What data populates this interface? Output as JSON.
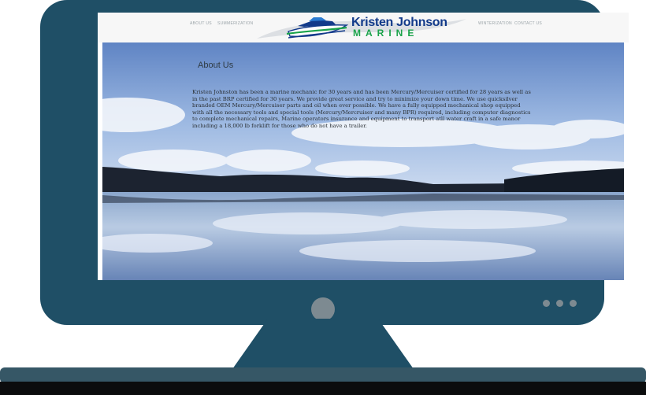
{
  "site": {
    "nav": {
      "about": "ABOUT US",
      "summerization": "SUMMERIZATION",
      "winterization": "WINTERIZATION",
      "contact": "CONTACT US"
    },
    "logo": {
      "line1": "Kristen Johnson",
      "line2": "MARINE"
    }
  },
  "content": {
    "heading": "About Us",
    "body": "Kristen Johnston has been a marine mechanic for 30 years and has been Mercury/Mercuiser certified for 28 years as well as in the past BRP certified for 30 years. We provide great service and try to minimize your down time. We use quicksilver branded OEM Mercury/Mercuiser parts and oil when ever possible. We have a fully equipped mechanical shop equipped with all the necessary tools and special tools (Mercury/Mercruiser and many BPR) required, including computer diagnostics to complete mechanical repairs, Marine operators insurance and equipment to transport atll water craft in a safe manor including a 18,000 lb forklift for those who do not have a trailer."
  },
  "colors": {
    "monitor": "#1f4f66",
    "logo_blue": "#123a8a",
    "logo_green": "#1aa34a"
  }
}
